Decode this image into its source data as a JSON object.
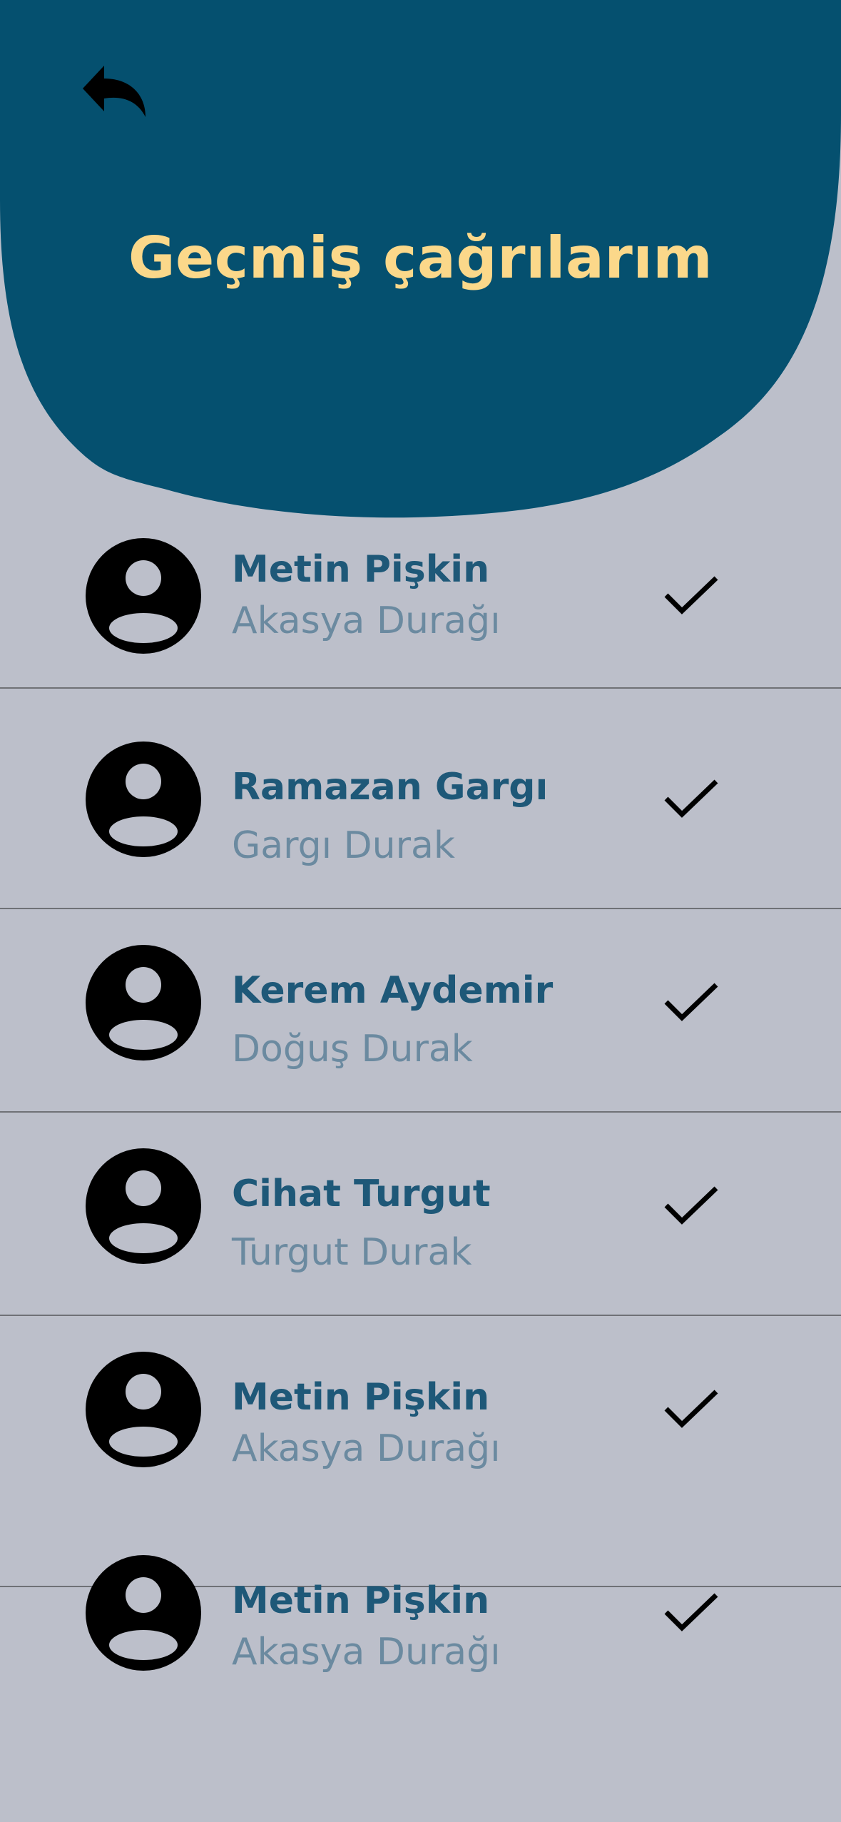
{
  "header": {
    "title": "Geçmiş çağrılarım",
    "background_color": "#05506f",
    "title_color": "#fbd88a"
  },
  "icons": {
    "back": "reply-arrow-icon",
    "avatar": "person-circle-icon",
    "status": "checkmark-icon"
  },
  "calls": [
    {
      "name": "Metin Pişkin",
      "stop": "Akasya Durağı"
    },
    {
      "name": "Ramazan Gargı",
      "stop": "Gargı Durak"
    },
    {
      "name": "Kerem Aydemir",
      "stop": "Doğuş Durak"
    },
    {
      "name": "Cihat Turgut",
      "stop": "Turgut Durak"
    },
    {
      "name": "Metin Pişkin",
      "stop": "Akasya Durağı"
    },
    {
      "name": "Metin Pişkin",
      "stop": "Akasya Durağı"
    }
  ],
  "colors": {
    "page_background": "#bcbfca",
    "name_text": "#1e5878",
    "stop_text": "#6b8aa0"
  }
}
